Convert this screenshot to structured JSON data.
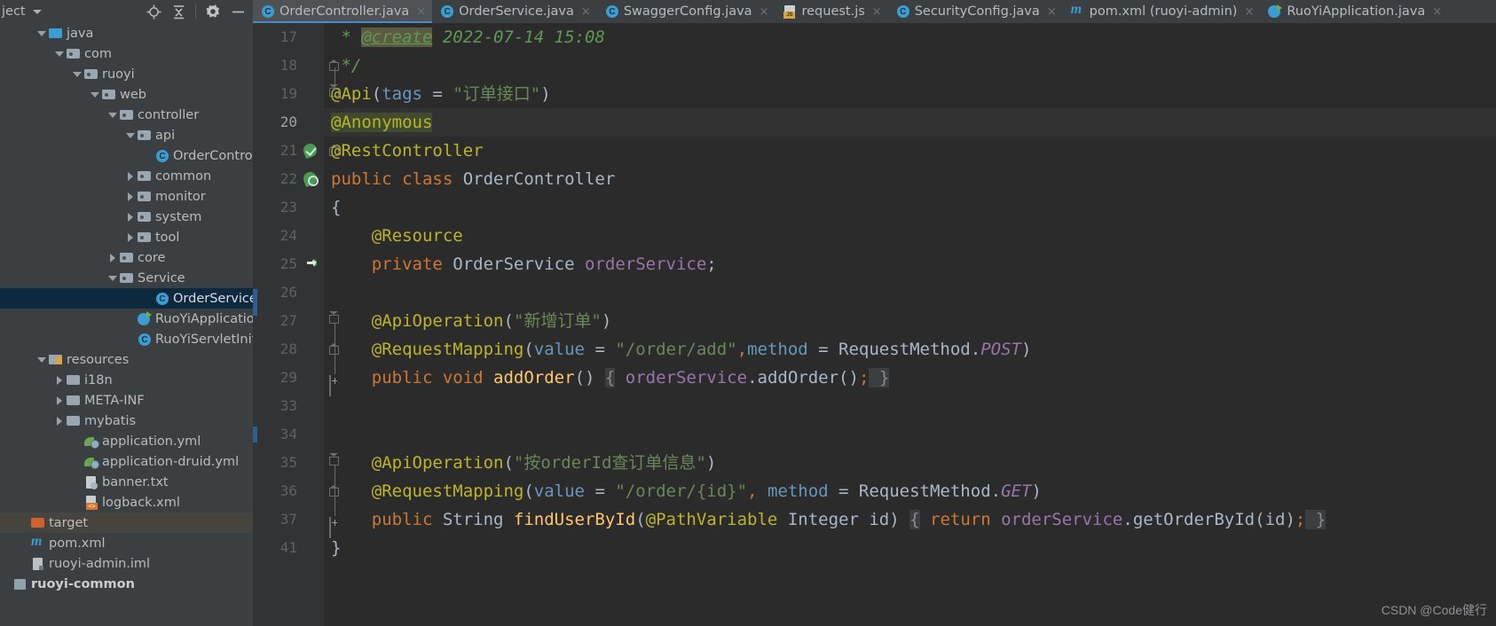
{
  "project_panel": {
    "title": "ject",
    "dropdown_icon": "chevron-down-icon",
    "toolbar_icons": [
      "locate-icon",
      "collapse-all-icon",
      "settings-gear-icon",
      "minimize-icon"
    ],
    "tree": [
      {
        "label": "java",
        "depth": 2,
        "arrow": "down",
        "icon": "folder-source",
        "state": "partial"
      },
      {
        "label": "com",
        "depth": 3,
        "arrow": "down",
        "icon": "folder"
      },
      {
        "label": "ruoyi",
        "depth": 4,
        "arrow": "down",
        "icon": "folder"
      },
      {
        "label": "web",
        "depth": 5,
        "arrow": "down",
        "icon": "folder"
      },
      {
        "label": "controller",
        "depth": 6,
        "arrow": "down",
        "icon": "folder"
      },
      {
        "label": "api",
        "depth": 7,
        "arrow": "down",
        "icon": "folder"
      },
      {
        "label": "OrderContro",
        "depth": 8,
        "arrow": "none",
        "icon": "java-class"
      },
      {
        "label": "common",
        "depth": 7,
        "arrow": "right",
        "icon": "folder"
      },
      {
        "label": "monitor",
        "depth": 7,
        "arrow": "right",
        "icon": "folder"
      },
      {
        "label": "system",
        "depth": 7,
        "arrow": "right",
        "icon": "folder"
      },
      {
        "label": "tool",
        "depth": 7,
        "arrow": "right",
        "icon": "folder"
      },
      {
        "label": "core",
        "depth": 6,
        "arrow": "right",
        "icon": "folder"
      },
      {
        "label": "Service",
        "depth": 6,
        "arrow": "down",
        "icon": "folder"
      },
      {
        "label": "OrderService",
        "depth": 8,
        "arrow": "none",
        "icon": "java-class",
        "selected": true
      },
      {
        "label": "RuoYiApplication",
        "depth": 7,
        "arrow": "none",
        "icon": "java-class-runnable"
      },
      {
        "label": "RuoYiServletInitializer",
        "depth": 7,
        "arrow": "none",
        "icon": "java-class"
      },
      {
        "label": "resources",
        "depth": 2,
        "arrow": "down",
        "icon": "folder-resources"
      },
      {
        "label": "i18n",
        "depth": 3,
        "arrow": "right",
        "icon": "folder-plain"
      },
      {
        "label": "META-INF",
        "depth": 3,
        "arrow": "right",
        "icon": "folder-plain"
      },
      {
        "label": "mybatis",
        "depth": 3,
        "arrow": "right",
        "icon": "folder-plain"
      },
      {
        "label": "application.yml",
        "depth": 4,
        "arrow": "none",
        "icon": "spring-yml"
      },
      {
        "label": "application-druid.yml",
        "depth": 4,
        "arrow": "none",
        "icon": "spring-yml"
      },
      {
        "label": "banner.txt",
        "depth": 4,
        "arrow": "none",
        "icon": "text-file"
      },
      {
        "label": "logback.xml",
        "depth": 4,
        "arrow": "none",
        "icon": "xml-file"
      },
      {
        "label": "target",
        "depth": 1,
        "arrow": "none",
        "icon": "folder-target",
        "hovered": true
      },
      {
        "label": "pom.xml",
        "depth": 1,
        "arrow": "none",
        "icon": "maven-file"
      },
      {
        "label": "ruoyi-admin.iml",
        "depth": 1,
        "arrow": "none",
        "icon": "iml-file"
      },
      {
        "label": "ruoyi-common",
        "depth": 0,
        "arrow": "none",
        "icon": "module",
        "bold": true
      }
    ]
  },
  "tabs": [
    {
      "label": "OrderController.java",
      "icon": "java-class-icon",
      "active": true,
      "close": "×"
    },
    {
      "label": "OrderService.java",
      "icon": "java-class-icon",
      "active": false,
      "close": "×"
    },
    {
      "label": "SwaggerConfig.java",
      "icon": "java-class-icon",
      "active": false,
      "close": "×"
    },
    {
      "label": "request.js",
      "icon": "javascript-file-icon",
      "active": false,
      "close": "×"
    },
    {
      "label": "SecurityConfig.java",
      "icon": "java-class-icon",
      "active": false,
      "close": "×"
    },
    {
      "label": "pom.xml (ruoyi-admin)",
      "icon": "maven-file-icon",
      "active": false,
      "close": "×"
    },
    {
      "label": "RuoYiApplication.java",
      "icon": "java-class-runnable-icon",
      "active": false,
      "close": "×"
    }
  ],
  "code": {
    "lines": [
      {
        "num": "17",
        "current": false,
        "gutter": "none",
        "fold": "none",
        "segments": [
          {
            "t": " * ",
            "c": "t-cmt"
          },
          {
            "t": "@create",
            "c": "t-cmtTag"
          },
          {
            "t": " 2022-07-14 15:08",
            "c": "t-cmt"
          }
        ]
      },
      {
        "num": "18",
        "current": false,
        "gutter": "none",
        "fold": "home",
        "segments": [
          {
            "t": " */",
            "c": "t-cmt"
          }
        ]
      },
      {
        "num": "19",
        "current": false,
        "gutter": "none",
        "fold": "vend",
        "segments": [
          {
            "t": "@Api",
            "c": "t-ann"
          },
          {
            "t": "(",
            "c": "t-def"
          },
          {
            "t": "tags",
            "c": "t-num"
          },
          {
            "t": " = ",
            "c": "t-def"
          },
          {
            "t": "\"订单接口\"",
            "c": "t-str"
          },
          {
            "t": ")",
            "c": "t-def"
          }
        ]
      },
      {
        "num": "20",
        "current": true,
        "gutter": "none",
        "fold": "none",
        "segments": [
          {
            "t": "@Anonymous",
            "c": "t-ann hl-ann"
          }
        ]
      },
      {
        "num": "21",
        "current": false,
        "gutter": "impl-check",
        "fold": "home",
        "segments": [
          {
            "t": "@RestController",
            "c": "t-ann"
          }
        ]
      },
      {
        "num": "22",
        "current": false,
        "gutter": "impl-bean",
        "fold": "none",
        "segments": [
          {
            "t": "public ",
            "c": "t-kw"
          },
          {
            "t": "class ",
            "c": "t-kw"
          },
          {
            "t": "OrderController",
            "c": "t-cls"
          }
        ]
      },
      {
        "num": "23",
        "current": false,
        "gutter": "none",
        "fold": "none",
        "segments": [
          {
            "t": "{",
            "c": "t-def"
          }
        ]
      },
      {
        "num": "24",
        "current": false,
        "gutter": "none",
        "fold": "none",
        "segments": [
          {
            "t": "    @Resource",
            "c": "t-ann"
          }
        ]
      },
      {
        "num": "25",
        "current": false,
        "gutter": "impl-arrow",
        "fold": "none",
        "segments": [
          {
            "t": "    ",
            "c": "t-def"
          },
          {
            "t": "private ",
            "c": "t-kw"
          },
          {
            "t": "OrderService ",
            "c": "t-cls"
          },
          {
            "t": "orderService",
            "c": "t-fld"
          },
          {
            "t": ";",
            "c": "t-def"
          }
        ]
      },
      {
        "num": "26",
        "current": false,
        "gutter": "none",
        "fold": "none",
        "segments": []
      },
      {
        "num": "27",
        "current": false,
        "gutter": "none",
        "fold": "vend",
        "segments": [
          {
            "t": "    @ApiOperation",
            "c": "t-ann"
          },
          {
            "t": "(",
            "c": "t-def"
          },
          {
            "t": "\"新增订单\"",
            "c": "t-str"
          },
          {
            "t": ")",
            "c": "t-def"
          }
        ]
      },
      {
        "num": "28",
        "current": false,
        "gutter": "none",
        "fold": "home",
        "segments": [
          {
            "t": "    @RequestMapping",
            "c": "t-ann"
          },
          {
            "t": "(",
            "c": "t-def"
          },
          {
            "t": "value",
            "c": "t-num"
          },
          {
            "t": " = ",
            "c": "t-def"
          },
          {
            "t": "\"/order/add\"",
            "c": "t-str"
          },
          {
            "t": ",",
            "c": "t-kw"
          },
          {
            "t": "method",
            "c": "t-num"
          },
          {
            "t": " = ",
            "c": "t-def"
          },
          {
            "t": "RequestMethod.",
            "c": "t-def"
          },
          {
            "t": "POST",
            "c": "t-static"
          },
          {
            "t": ")",
            "c": "t-def"
          }
        ]
      },
      {
        "num": "29",
        "current": false,
        "gutter": "none",
        "fold": "plus",
        "segments": [
          {
            "t": "    ",
            "c": "t-def"
          },
          {
            "t": "public ",
            "c": "t-kw"
          },
          {
            "t": "void ",
            "c": "t-kw"
          },
          {
            "t": "addOrder",
            "c": "t-meth"
          },
          {
            "t": "() ",
            "c": "t-def"
          },
          {
            "t": "{",
            "c": "t-def fold-brace"
          },
          {
            "t": " ",
            "c": "t-def"
          },
          {
            "t": "orderService",
            "c": "t-fld"
          },
          {
            "t": ".",
            "c": "t-def"
          },
          {
            "t": "addOrder",
            "c": "t-def"
          },
          {
            "t": "()",
            "c": "t-def"
          },
          {
            "t": ";",
            "c": "t-kw"
          },
          {
            "t": " }",
            "c": "t-def fold-brace"
          }
        ]
      },
      {
        "num": "33",
        "current": false,
        "gutter": "none",
        "fold": "none",
        "segments": []
      },
      {
        "num": "34",
        "current": false,
        "gutter": "none",
        "fold": "none",
        "segments": []
      },
      {
        "num": "35",
        "current": false,
        "gutter": "none",
        "fold": "vend",
        "segments": [
          {
            "t": "    @ApiOperation",
            "c": "t-ann"
          },
          {
            "t": "(",
            "c": "t-def"
          },
          {
            "t": "\"按orderId查订单信息\"",
            "c": "t-str"
          },
          {
            "t": ")",
            "c": "t-def"
          }
        ]
      },
      {
        "num": "36",
        "current": false,
        "gutter": "none",
        "fold": "home",
        "segments": [
          {
            "t": "    @RequestMapping",
            "c": "t-ann"
          },
          {
            "t": "(",
            "c": "t-def"
          },
          {
            "t": "value",
            "c": "t-num"
          },
          {
            "t": " = ",
            "c": "t-def"
          },
          {
            "t": "\"/order/{id}\"",
            "c": "t-str"
          },
          {
            "t": ",",
            "c": "t-kw"
          },
          {
            "t": " ",
            "c": "t-def"
          },
          {
            "t": "method",
            "c": "t-num"
          },
          {
            "t": " = ",
            "c": "t-def"
          },
          {
            "t": "RequestMethod.",
            "c": "t-def"
          },
          {
            "t": "GET",
            "c": "t-static"
          },
          {
            "t": ")",
            "c": "t-def"
          }
        ]
      },
      {
        "num": "37",
        "current": false,
        "gutter": "none",
        "fold": "plus",
        "segments": [
          {
            "t": "    ",
            "c": "t-def"
          },
          {
            "t": "public ",
            "c": "t-kw"
          },
          {
            "t": "String ",
            "c": "t-def"
          },
          {
            "t": "findUserById",
            "c": "t-meth"
          },
          {
            "t": "(",
            "c": "t-def"
          },
          {
            "t": "@PathVariable",
            "c": "t-ann"
          },
          {
            "t": " Integer ",
            "c": "t-def"
          },
          {
            "t": "id",
            "c": "t-def"
          },
          {
            "t": ") ",
            "c": "t-def"
          },
          {
            "t": "{",
            "c": "t-def fold-brace"
          },
          {
            "t": " ",
            "c": "t-def"
          },
          {
            "t": "return ",
            "c": "t-kw"
          },
          {
            "t": "orderService",
            "c": "t-fld"
          },
          {
            "t": ".",
            "c": "t-def"
          },
          {
            "t": "getOrderById",
            "c": "t-def"
          },
          {
            "t": "(",
            "c": "t-def"
          },
          {
            "t": "id",
            "c": "t-def"
          },
          {
            "t": ")",
            "c": "t-def"
          },
          {
            "t": ";",
            "c": "t-kw"
          },
          {
            "t": " }",
            "c": "t-def fold-brace"
          }
        ]
      },
      {
        "num": "41",
        "current": false,
        "gutter": "none",
        "fold": "none",
        "segments": [
          {
            "t": "}",
            "c": "t-def"
          }
        ]
      }
    ]
  },
  "watermark": "CSDN @Code健行",
  "colors": {
    "panel_bg": "#3c3f41",
    "editor_bg": "#2b2b2b",
    "gutter_bg": "#313335",
    "selection_blue": "#0d293e",
    "tab_active": "#4e5254",
    "tab_underline": "#4a88c7",
    "annotation": "#bbb529",
    "keyword": "#cc7832",
    "string": "#6a8759",
    "comment": "#629755",
    "field": "#9876aa",
    "method": "#ffc66d"
  }
}
